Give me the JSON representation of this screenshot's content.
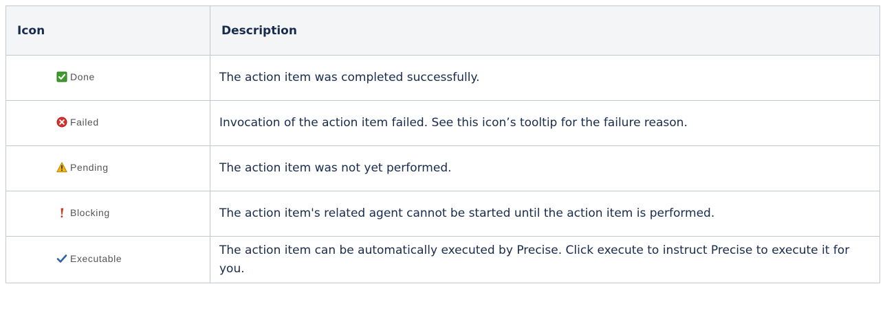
{
  "table": {
    "headers": {
      "icon": "Icon",
      "description": "Description"
    },
    "rows": [
      {
        "icon_name": "done-checkbox-icon",
        "icon_color": "#3c9c2c",
        "label": "Done",
        "description": "The action item was completed successfully."
      },
      {
        "icon_name": "failed-x-icon",
        "icon_color": "#d9322c",
        "label": "Failed",
        "description": "Invocation of the action item failed. See this icon’s tooltip for the failure reason."
      },
      {
        "icon_name": "pending-warning-icon",
        "icon_color": "#f2b70c",
        "label": "Pending",
        "description": "The action item was not yet performed."
      },
      {
        "icon_name": "blocking-exclamation-icon",
        "icon_color": "#d9301c",
        "label": "Blocking",
        "description": "The action item's related agent cannot be started until the action item is performed."
      },
      {
        "icon_name": "executable-checkmark-icon",
        "icon_color": "#2e5fa8",
        "label": "Executable",
        "description": "The action item can be automatically executed by Precise. Click execute to instruct Precise to execute it for you."
      }
    ]
  }
}
